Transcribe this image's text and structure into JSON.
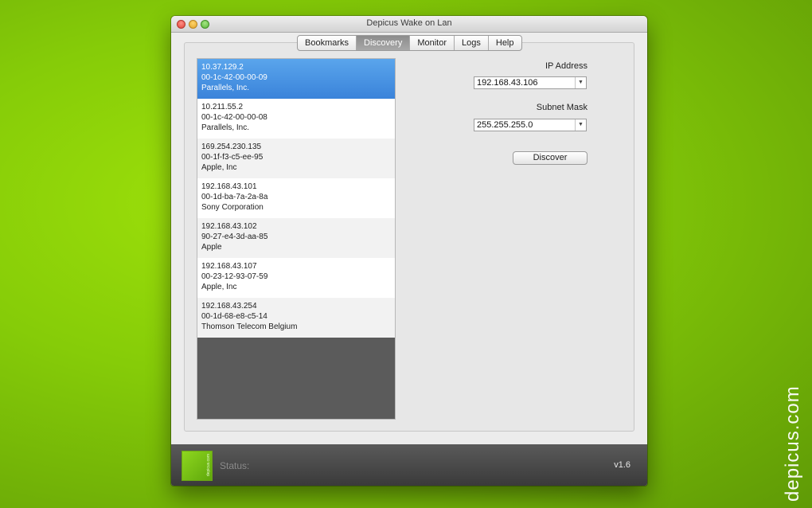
{
  "window": {
    "title": "Depicus Wake on Lan"
  },
  "tabs": [
    {
      "label": "Bookmarks",
      "active": false
    },
    {
      "label": "Discovery",
      "active": true
    },
    {
      "label": "Monitor",
      "active": false
    },
    {
      "label": "Logs",
      "active": false
    },
    {
      "label": "Help",
      "active": false
    }
  ],
  "devices": [
    {
      "ip": "10.37.129.2",
      "mac": "00-1c-42-00-00-09",
      "vendor": "Parallels, Inc.",
      "selected": true
    },
    {
      "ip": "10.211.55.2",
      "mac": "00-1c-42-00-00-08",
      "vendor": "Parallels, Inc.",
      "selected": false
    },
    {
      "ip": "169.254.230.135",
      "mac": "00-1f-f3-c5-ee-95",
      "vendor": "Apple, Inc",
      "selected": false
    },
    {
      "ip": "192.168.43.101",
      "mac": "00-1d-ba-7a-2a-8a",
      "vendor": "Sony Corporation",
      "selected": false
    },
    {
      "ip": "192.168.43.102",
      "mac": "90-27-e4-3d-aa-85",
      "vendor": "Apple",
      "selected": false
    },
    {
      "ip": "192.168.43.107",
      "mac": "00-23-12-93-07-59",
      "vendor": "Apple, Inc",
      "selected": false
    },
    {
      "ip": "192.168.43.254",
      "mac": "00-1d-68-e8-c5-14",
      "vendor": "Thomson Telecom Belgium",
      "selected": false
    }
  ],
  "form": {
    "ip_label": "IP Address",
    "ip_value": "192.168.43.106",
    "mask_label": "Subnet Mask",
    "mask_value": "255.255.255.0",
    "discover_label": "Discover"
  },
  "statusbar": {
    "logo_text": "depicus.com",
    "status_label": "Status:",
    "version": "v1.6"
  },
  "watermark": "depicus.com",
  "colors": {
    "selection": "#3a83da",
    "background": "#86cc08"
  }
}
